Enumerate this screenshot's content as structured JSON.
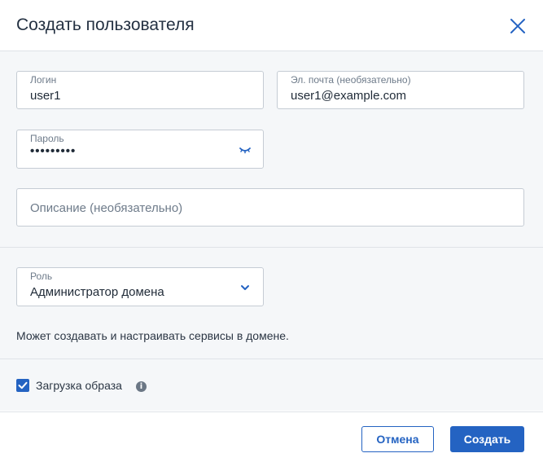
{
  "dialog": {
    "title": "Создать пользователя"
  },
  "form": {
    "login": {
      "label": "Логин",
      "value": "user1"
    },
    "email": {
      "label": "Эл. почта (необязательно)",
      "value": "user1@example.com"
    },
    "password": {
      "label": "Пароль",
      "value": "•••••••••"
    },
    "description": {
      "placeholder": "Описание (необязательно)"
    },
    "role": {
      "label": "Роль",
      "value": "Администратор домена"
    },
    "role_description": "Может создавать и настраивать сервисы в домене.",
    "image_upload": {
      "label": "Загрузка образа",
      "checked": true,
      "info_glyph": "i"
    }
  },
  "footer": {
    "cancel_label": "Отмена",
    "create_label": "Создать"
  },
  "colors": {
    "accent": "#2463c2",
    "body_bg": "#f5f7f9",
    "border": "#c5ccd4"
  },
  "icons": {
    "close": "close-icon",
    "password_toggle": "eye-closed-icon",
    "role_dropdown": "chevron-down-icon",
    "checkbox": "checkmark-icon",
    "info": "info-icon"
  }
}
